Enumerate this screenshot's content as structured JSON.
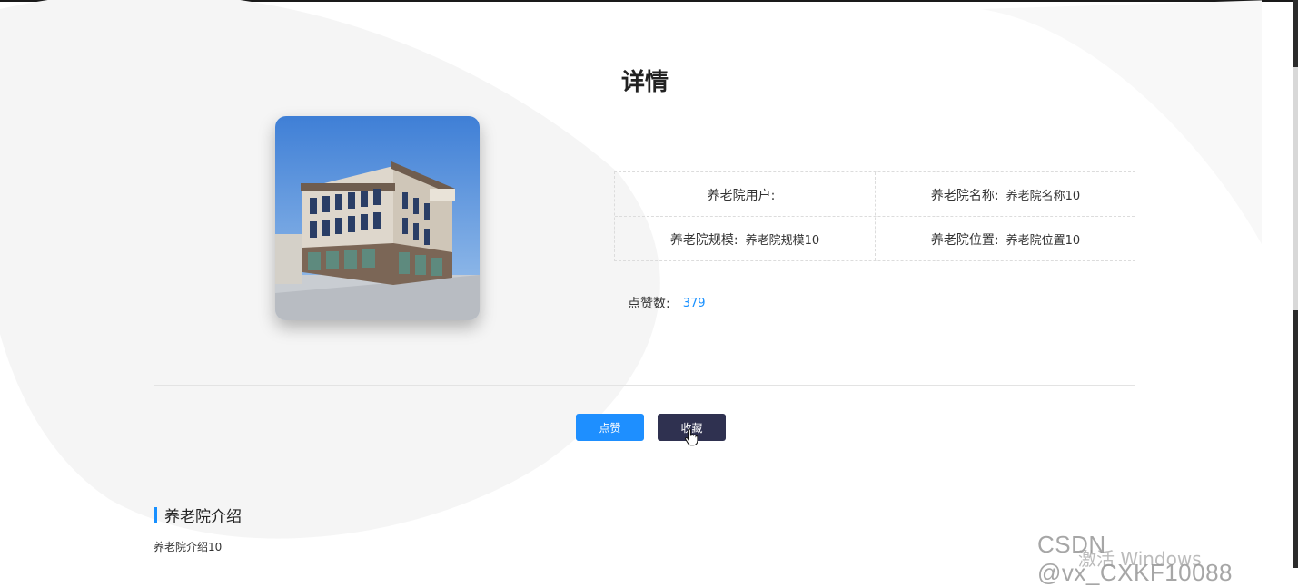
{
  "page": {
    "title": "详情"
  },
  "details": {
    "user_label": "养老院用户:",
    "user_value": "",
    "name_label": "养老院名称:",
    "name_value": "养老院名称10",
    "scale_label": "养老院规模:",
    "scale_value": "养老院规模10",
    "location_label": "养老院位置:",
    "location_value": "养老院位置10"
  },
  "likes": {
    "label": "点赞数:",
    "count": "379"
  },
  "buttons": {
    "like_label": "点赞",
    "favorite_label": "收藏"
  },
  "intro": {
    "heading": "养老院介绍",
    "text": "养老院介绍10"
  },
  "overlays": {
    "windows_watermark": "激活 Windows",
    "csdn_watermark": "CSDN @vx_CXKF10088"
  },
  "colors": {
    "accent": "#1890ff",
    "like_button": "#1e8fff",
    "favorite_button": "#2f3150"
  },
  "icons": [
    "pointer-cursor-icon"
  ]
}
